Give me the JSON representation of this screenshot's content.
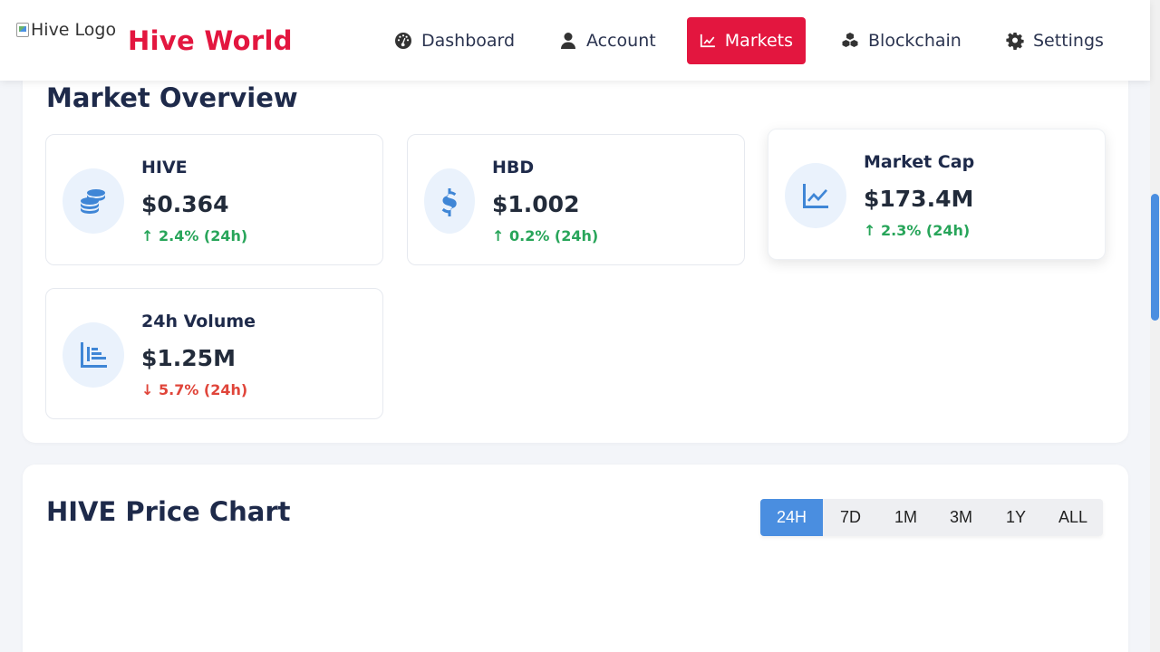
{
  "header": {
    "logo_alt": "Hive Logo",
    "brand": "Hive World",
    "nav": [
      {
        "label": "Dashboard",
        "icon": "gauge-icon"
      },
      {
        "label": "Account",
        "icon": "user-icon"
      },
      {
        "label": "Markets",
        "icon": "chart-line-icon",
        "active": true
      },
      {
        "label": "Blockchain",
        "icon": "cubes-icon"
      },
      {
        "label": "Settings",
        "icon": "gear-icon"
      }
    ]
  },
  "market": {
    "title": "Market Overview",
    "cards": [
      {
        "name": "HIVE",
        "value": "$0.364",
        "change": "↑ 2.4% (24h)",
        "direction": "up",
        "icon": "coins-icon"
      },
      {
        "name": "HBD",
        "value": "$1.002",
        "change": "↑ 0.2% (24h)",
        "direction": "up",
        "icon": "dollar-icon"
      },
      {
        "name": "Market Cap",
        "value": "$173.4M",
        "change": "↑ 2.3% (24h)",
        "direction": "up",
        "icon": "chart-line-icon"
      },
      {
        "name": "24h Volume",
        "value": "$1.25M",
        "change": "↓ 5.7% (24h)",
        "direction": "down",
        "icon": "chart-bar-icon"
      }
    ]
  },
  "chart": {
    "title": "HIVE Price Chart",
    "ranges": [
      "24H",
      "7D",
      "1M",
      "3M",
      "1Y",
      "ALL"
    ],
    "active_range": "24H"
  },
  "colors": {
    "brand": "#e3163f",
    "accent": "#4a8ee0",
    "up": "#28a55a",
    "down": "#e0453a"
  }
}
